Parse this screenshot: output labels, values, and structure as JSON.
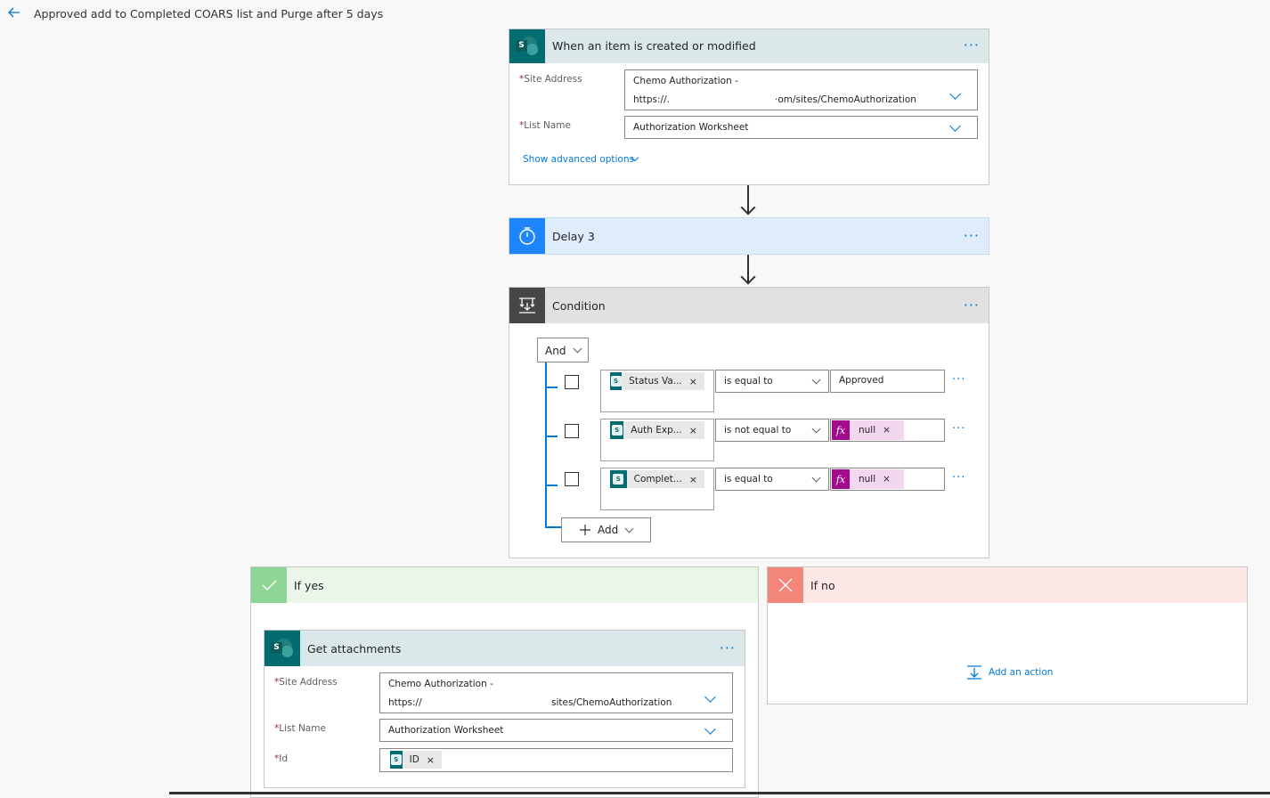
{
  "app": {
    "title": "Approved add to Completed COARS list and Purge after 5 days",
    "back_icon": "arrow-left-icon"
  },
  "trigger": {
    "title": "When an item is created or modified",
    "more": "···",
    "site_address_label": "Site Address",
    "site_address_line1": "Chemo Authorization -",
    "site_address_line2a": "https://.",
    "site_address_line2b": "·om/sites/ChemoAuthorization",
    "list_name_label": "List Name",
    "list_name_value": "Authorization Worksheet",
    "advanced_link": "Show advanced options",
    "required_mark": "*"
  },
  "delay": {
    "title": "Delay 3",
    "more": "···"
  },
  "condition": {
    "title": "Condition",
    "more": "···",
    "group_operator": "And",
    "rows": [
      {
        "token": "Status Va...",
        "operator": "is equal to",
        "value": "Approved",
        "value_is_fx": false
      },
      {
        "token": "Auth Exp...",
        "operator": "is not equal to",
        "value": "null",
        "value_is_fx": true
      },
      {
        "token": "Complet...",
        "operator": "is equal to",
        "value": "null",
        "value_is_fx": true
      }
    ],
    "add_label": "Add",
    "token_close": "×",
    "fx_label": "fx",
    "row_more": "···"
  },
  "if_yes": {
    "title": "If yes",
    "color": "#8fd694"
  },
  "if_no": {
    "title": "If no",
    "color": "#f3857a",
    "add_action_label": "Add an action"
  },
  "get_attachments": {
    "title": "Get attachments",
    "more": "···",
    "site_address_label": "Site Address",
    "site_address_line1": "Chemo Authorization -",
    "site_address_line2a": "https://",
    "site_address_line2b": "sites/ChemoAuthorization",
    "list_name_label": "List Name",
    "list_name_value": "Authorization Worksheet",
    "id_label": "Id",
    "id_token": "ID"
  },
  "colors": {
    "accent": "#0078d4",
    "sharepoint": "#036c70",
    "trigger_header": "#dbe8ea",
    "delay_header": "#dfecfb",
    "delay_icon": "#1f85ff",
    "condition_header": "#e1e1e1",
    "condition_icon": "#484644",
    "yes_header": "#ebf6eb",
    "no_header": "#fde7e7"
  }
}
